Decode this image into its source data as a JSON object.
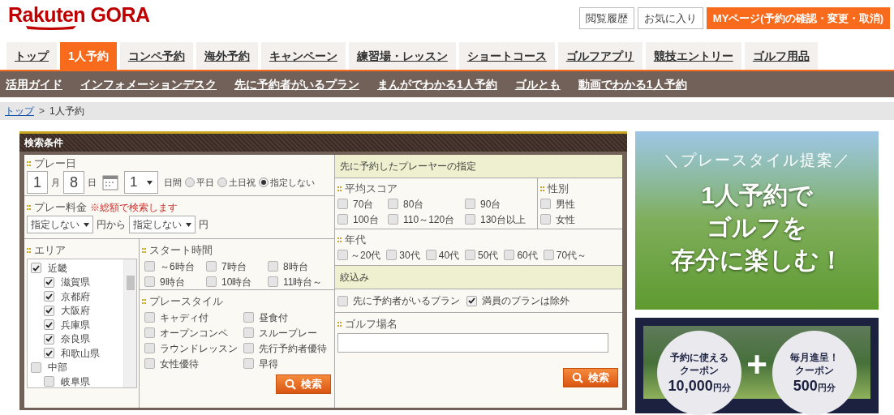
{
  "logo": {
    "text": "Rakuten GORA"
  },
  "header_buttons": [
    {
      "label": "閲覧履歴",
      "kind": "outline"
    },
    {
      "label": "お気に入り",
      "kind": "outline"
    },
    {
      "label": "MYページ(予約の確認・変更・取消)",
      "kind": "primary"
    }
  ],
  "tabs": [
    {
      "label": "トップ",
      "selected": false
    },
    {
      "label": "1人予約",
      "selected": true
    },
    {
      "label": "コンペ予約",
      "selected": false
    },
    {
      "label": "海外予約",
      "selected": false
    },
    {
      "label": "キャンペーン",
      "selected": false
    },
    {
      "label": "練習場・レッスン",
      "selected": false
    },
    {
      "label": "ショートコース",
      "selected": false
    },
    {
      "label": "ゴルフアプリ",
      "selected": false
    },
    {
      "label": "競技エントリー",
      "selected": false
    },
    {
      "label": "ゴルフ用品",
      "selected": false
    }
  ],
  "subnav": [
    "活用ガイド",
    "インフォメーションデスク",
    "先に予約者がいるプラン",
    "まんがでわかる1人予約",
    "ゴルとも",
    "動画でわかる1人予約"
  ],
  "breadcrumb": [
    {
      "label": "トップ",
      "kind": "link"
    },
    {
      "label": ">",
      "kind": "separator"
    },
    {
      "label": "1人予約",
      "kind": "current"
    }
  ],
  "search_panel": {
    "title": "検索条件",
    "play_date": {
      "label": "プレー日",
      "month": "1",
      "month_unit": "月",
      "day": "8",
      "day_unit": "日",
      "days": "1",
      "days_unit": "日間",
      "day_types": [
        {
          "label": "平日",
          "selected": false
        },
        {
          "label": "土日祝",
          "selected": false
        },
        {
          "label": "指定しない",
          "selected": true
        }
      ]
    },
    "fee": {
      "label": "プレー料金",
      "note": "※総額で検索します",
      "min": "指定しない",
      "min_unit": "円から",
      "max": "指定しない",
      "max_unit": "円"
    },
    "area": {
      "label": "エリア",
      "regions": [
        {
          "label": "近畿",
          "checked": true,
          "children": [
            {
              "label": "滋賀県",
              "checked": true
            },
            {
              "label": "京都府",
              "checked": true
            },
            {
              "label": "大阪府",
              "checked": true
            },
            {
              "label": "兵庫県",
              "checked": true
            },
            {
              "label": "奈良県",
              "checked": true
            },
            {
              "label": "和歌山県",
              "checked": true
            }
          ]
        },
        {
          "label": "中部",
          "checked": false,
          "children": [
            {
              "label": "岐阜県",
              "checked": false
            }
          ]
        }
      ]
    },
    "start_time": {
      "label": "スタート時間",
      "options": [
        {
          "label": "～6時台",
          "checked": false
        },
        {
          "label": "7時台",
          "checked": false
        },
        {
          "label": "8時台",
          "checked": false
        },
        {
          "label": "9時台",
          "checked": false
        },
        {
          "label": "10時台",
          "checked": false
        },
        {
          "label": "11時台～",
          "checked": false
        }
      ]
    },
    "play_style": {
      "label": "プレースタイル",
      "options": [
        {
          "label": "キャディ付",
          "checked": false
        },
        {
          "label": "昼食付",
          "checked": false
        },
        {
          "label": "オープンコンペ",
          "checked": false
        },
        {
          "label": "スループレー",
          "checked": false
        },
        {
          "label": "ラウンドレッスン",
          "checked": false
        },
        {
          "label": "先行予約者優待",
          "checked": false
        },
        {
          "label": "女性優待",
          "checked": false
        },
        {
          "label": "早得",
          "checked": false
        }
      ]
    },
    "search_button_left": "検索",
    "player_filter": {
      "title": "先に予約したプレーヤーの指定",
      "average_score": {
        "label": "平均スコア",
        "options": [
          {
            "label": "70台",
            "checked": false
          },
          {
            "label": "80台",
            "checked": false
          },
          {
            "label": "90台",
            "checked": false
          },
          {
            "label": "100台",
            "checked": false
          },
          {
            "label": "110～120台",
            "checked": false
          },
          {
            "label": "130台以上",
            "checked": false
          }
        ]
      },
      "gender": {
        "label": "性別",
        "options": [
          {
            "label": "男性",
            "checked": false
          },
          {
            "label": "女性",
            "checked": false
          }
        ]
      },
      "age": {
        "label": "年代",
        "options": [
          {
            "label": "～20代",
            "checked": false
          },
          {
            "label": "30代",
            "checked": false
          },
          {
            "label": "40代",
            "checked": false
          },
          {
            "label": "50代",
            "checked": false
          },
          {
            "label": "60代",
            "checked": false
          },
          {
            "label": "70代～",
            "checked": false
          }
        ]
      }
    },
    "refine": {
      "title": "絞込み",
      "options": [
        {
          "label": "先に予約者がいるプラン",
          "checked": false
        },
        {
          "label": "満員のプランは除外",
          "checked": true
        }
      ]
    },
    "course_name": {
      "label": "ゴルフ場名"
    },
    "search_button_right": "検索"
  },
  "banners": [
    {
      "kind": "playstyle",
      "kicker": "＼プレースタイル提案／",
      "lines": [
        "1人予約で",
        "ゴルフを",
        "存分に楽しむ！"
      ]
    },
    {
      "kind": "coupon",
      "circles": [
        {
          "lines": [
            "予約に使える",
            "クーポン"
          ],
          "amount": "10,000",
          "unit": "円分"
        },
        {
          "lines": [
            "毎月進呈！",
            "クーポン"
          ],
          "amount": "500",
          "unit": "円分"
        }
      ],
      "joiner": "+"
    }
  ]
}
